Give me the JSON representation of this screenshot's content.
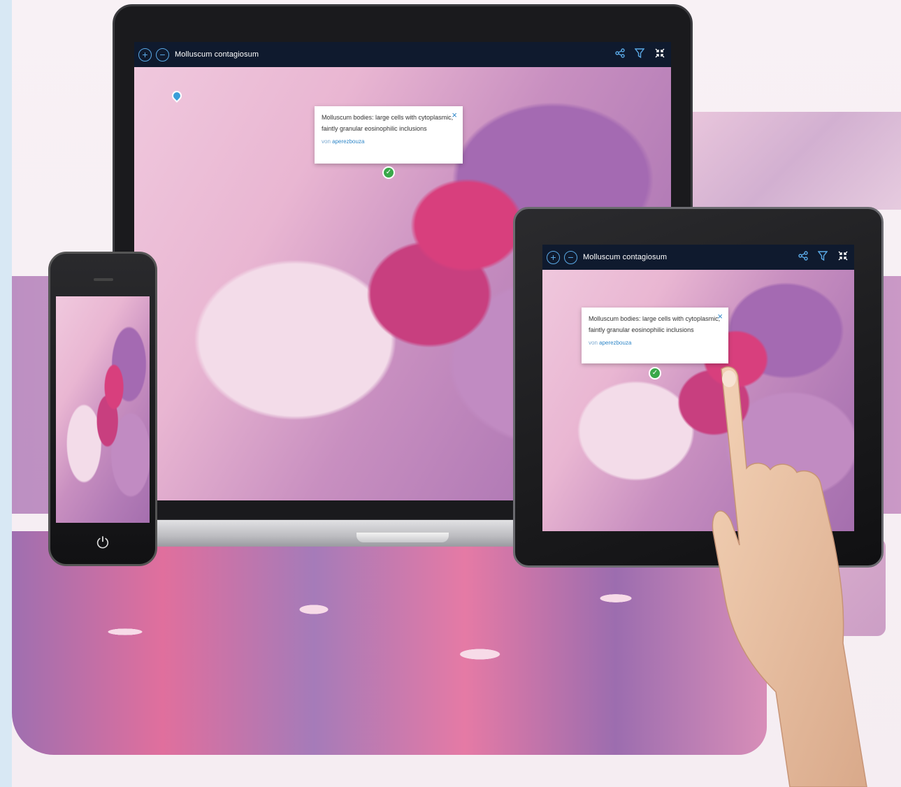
{
  "viewer": {
    "title": "Molluscum contagiosum",
    "zoom_in_symbol": "+",
    "zoom_out_symbol": "−",
    "icons": [
      "zoom-in-icon",
      "zoom-out-icon",
      "share-icon",
      "filter-icon",
      "collapse-icon"
    ]
  },
  "annotation": {
    "line1": "Molluscum bodies: large cells with cytoplasmic,",
    "line2": "faintly granular eosinophilic inclusions",
    "by_prefix": "von",
    "author": "aperezbouza",
    "close_symbol": "×",
    "check_symbol": "✓"
  },
  "phone": {
    "power_symbol": "⏻"
  },
  "colors": {
    "toolbar_bg": "#0f1a2e",
    "accent": "#5aa9e6",
    "link": "#2f87c8",
    "check": "#3aa84a",
    "stain_pink": "#d83f7d",
    "stain_purple": "#a46ab2"
  }
}
